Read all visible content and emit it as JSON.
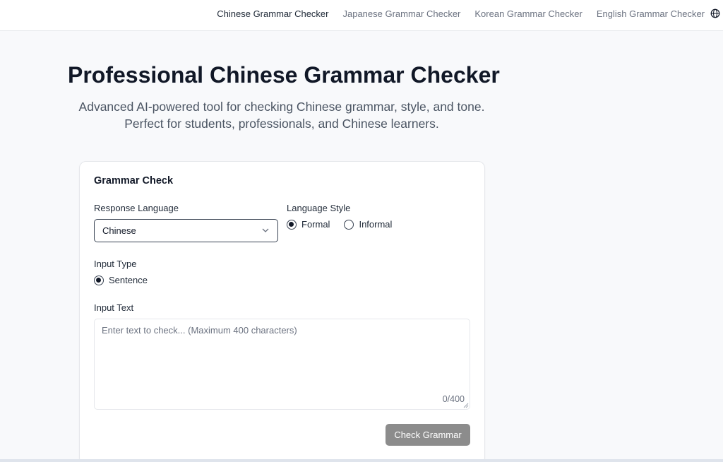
{
  "nav": {
    "links": [
      "Chinese Grammar Checker",
      "Japanese Grammar Checker",
      "Korean Grammar Checker",
      "English Grammar Checker"
    ],
    "active_index": 0,
    "language_icon": "globe-icon"
  },
  "hero": {
    "title": "Professional Chinese Grammar Checker",
    "subtitle_line1": "Advanced AI-powered tool for checking Chinese grammar, style, and tone.",
    "subtitle_line2": "Perfect for students, professionals, and Chinese learners."
  },
  "card": {
    "title": "Grammar Check",
    "response_language": {
      "label": "Response Language",
      "selected": "Chinese"
    },
    "language_style": {
      "label": "Language Style",
      "options": [
        "Formal",
        "Informal"
      ],
      "selected": "Formal"
    },
    "input_type": {
      "label": "Input Type",
      "options": [
        "Sentence"
      ],
      "selected": "Sentence"
    },
    "input_text": {
      "label": "Input Text",
      "placeholder": "Enter text to check... (Maximum 400 characters)",
      "value": "",
      "counter": "0/400"
    },
    "submit_label": "Check Grammar"
  },
  "colors": {
    "button_disabled": "#8c8c8c",
    "page_bg": "#f8f9fb",
    "text_primary": "#111827"
  }
}
